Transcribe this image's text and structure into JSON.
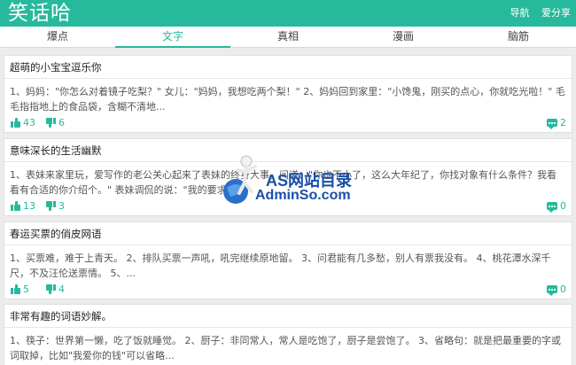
{
  "header": {
    "logo": "笑话哈",
    "links": [
      "导航",
      "爱分享"
    ]
  },
  "tabs": [
    "爆点",
    "文字",
    "真相",
    "漫画",
    "脑筋"
  ],
  "active_tab": "文字",
  "cards": [
    {
      "title": "超萌的小宝宝逗乐你",
      "body": "1、妈妈：\"你怎么对着镜子吃梨？\" 女儿：\"妈妈，我想吃两个梨！\" 2、妈妈回到家里：\"小馋鬼，刚买的点心，你就吃光啦！\" 毛毛指指地上的食品袋，含糊不清地...",
      "likes": "43",
      "dislikes": "6",
      "comments": "2"
    },
    {
      "title": "意味深长的生活幽默",
      "body": "1、表妹来家里玩，爱写作的老公关心起来了表妹的终身大事，问道：\"你也不小了，这么大年纪了，你找对象有什么条件？我看看有合适的你介绍个。\" 表妹调侃的说：\"我的要求不...",
      "likes": "13",
      "dislikes": "3",
      "comments": "0"
    },
    {
      "title": "春运买票的俏皮网语",
      "body": "1、买票难，难于上青天。 2、排队买票一声吼，吼完继续原地留。 3、问君能有几多愁，别人有票我没有。 4、桃花潭水深千尺，不及汪伦送票情。 5、...",
      "likes": "5",
      "dislikes": "4",
      "comments": "0"
    },
    {
      "title": "非常有趣的词语妙解。",
      "body": "1、筷子：世界第一懒，吃了饭就睡觉。 2、厨子：非同常人，常人是吃饱了，厨子是尝饱了。 3、省略句：就是把最重要的字或词取掉，比如\"我爱你的钱\"可以省略...",
      "likes": "",
      "dislikes": "",
      "comments": ""
    }
  ],
  "watermark": {
    "title": "AS网站目录",
    "url": "AdminSo.com"
  },
  "colors": {
    "accent": "#27b99c",
    "watermark": "#1a4fa8"
  }
}
